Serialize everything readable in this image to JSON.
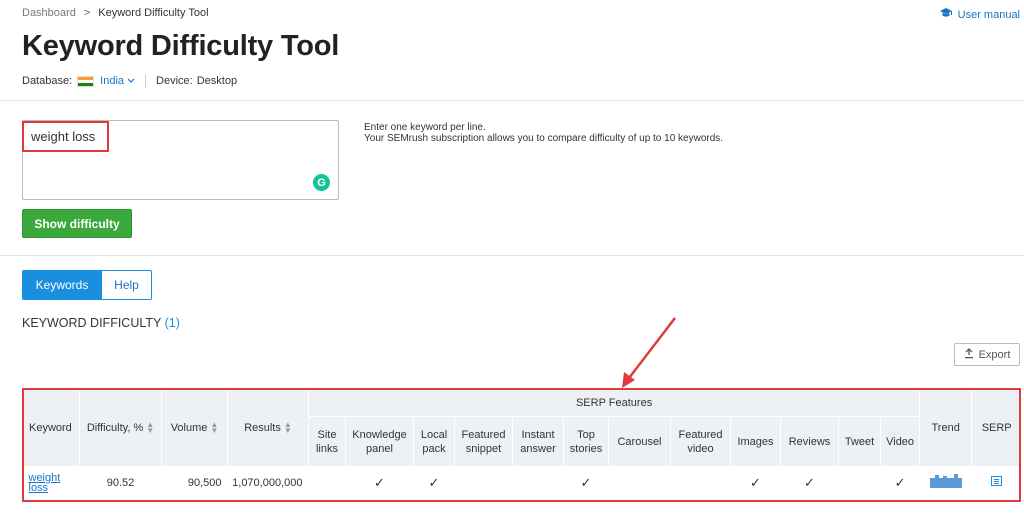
{
  "breadcrumb": {
    "root": "Dashboard",
    "separator": ">",
    "current": "Keyword Difficulty Tool"
  },
  "user_manual": {
    "label": "User manual",
    "icon": "graduation-cap-icon"
  },
  "page_title": "Keyword Difficulty Tool",
  "database": {
    "label": "Database:",
    "value": "India",
    "flag": "india-flag-icon"
  },
  "device": {
    "label": "Device:",
    "value": "Desktop"
  },
  "keyword_input": {
    "value": "weight loss"
  },
  "hint": {
    "line1": "Enter one keyword per line.",
    "line2": "Your SEMrush subscription allows you to compare difficulty of up to 10 keywords."
  },
  "show_button": {
    "label": "Show difficulty"
  },
  "tabs": [
    {
      "label": "Keywords",
      "active": true
    },
    {
      "label": "Help",
      "active": false
    }
  ],
  "section": {
    "title": "KEYWORD DIFFICULTY",
    "count": "(1)"
  },
  "export_button": {
    "label": "Export"
  },
  "table": {
    "headers": {
      "keyword": "Keyword",
      "difficulty": "Difficulty, %",
      "volume": "Volume",
      "results": "Results",
      "serp_features": "SERP Features",
      "trend": "Trend",
      "serp": "SERP"
    },
    "features": [
      {
        "line1": "Site",
        "line2": "links"
      },
      {
        "line1": "Knowledge",
        "line2": "panel"
      },
      {
        "line1": "Local",
        "line2": "pack"
      },
      {
        "line1": "Featured",
        "line2": "snippet"
      },
      {
        "line1": "Instant",
        "line2": "answer"
      },
      {
        "line1": "Top",
        "line2": "stories"
      },
      {
        "line1": "Carousel",
        "line2": ""
      },
      {
        "line1": "Featured",
        "line2": "video"
      },
      {
        "line1": "Images",
        "line2": ""
      },
      {
        "line1": "Reviews",
        "line2": ""
      },
      {
        "line1": "Tweet",
        "line2": ""
      },
      {
        "line1": "Video",
        "line2": ""
      }
    ],
    "row": {
      "keyword_line1": "weight",
      "keyword_line2": "loss",
      "difficulty": "90.52",
      "volume": "90,500",
      "results": "1,070,000,000",
      "check": "✓",
      "features_present": [
        false,
        true,
        true,
        false,
        false,
        true,
        false,
        false,
        true,
        true,
        false,
        true
      ]
    }
  },
  "colors": {
    "accent": "#1a8fe0",
    "green": "#3aa83a",
    "highlight": "#e03a3a"
  }
}
